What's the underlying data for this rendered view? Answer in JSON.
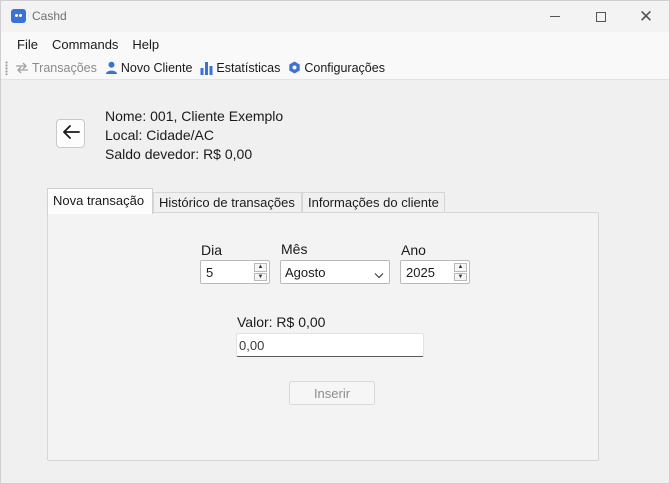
{
  "window": {
    "title": "Cashd",
    "controls": {
      "minimize": "minimize",
      "maximize": "maximize",
      "close": "close"
    }
  },
  "menu": [
    "File",
    "Commands",
    "Help"
  ],
  "toolbar": [
    {
      "label": "Transações",
      "icon": "transfer-icon",
      "enabled": false
    },
    {
      "label": "Novo Cliente",
      "icon": "person-icon",
      "enabled": true
    },
    {
      "label": "Estatísticas",
      "icon": "bar-chart-icon",
      "enabled": true
    },
    {
      "label": "Configurações",
      "icon": "gear-icon",
      "enabled": true
    }
  ],
  "client": {
    "name_line": "Nome: 001, Cliente Exemplo",
    "location_line": "Local: Cidade/AC",
    "balance_line": "Saldo devedor: R$ 0,00"
  },
  "tabs": [
    {
      "label": "Nova transação",
      "active": true
    },
    {
      "label": "Histórico de transações",
      "active": false
    },
    {
      "label": "Informações do cliente",
      "active": false
    }
  ],
  "form": {
    "day_label": "Dia",
    "day_value": "5",
    "month_label": "Mês",
    "month_value": "Agosto",
    "year_label": "Ano",
    "year_value": "2025",
    "amount_label": "Valor: R$ 0,00",
    "amount_value": "0,00",
    "submit_label": "Inserir"
  },
  "colors": {
    "accent": "#3a72d6",
    "window_bg": "#f0f0f0",
    "disabled_text": "#8a8a8a"
  }
}
